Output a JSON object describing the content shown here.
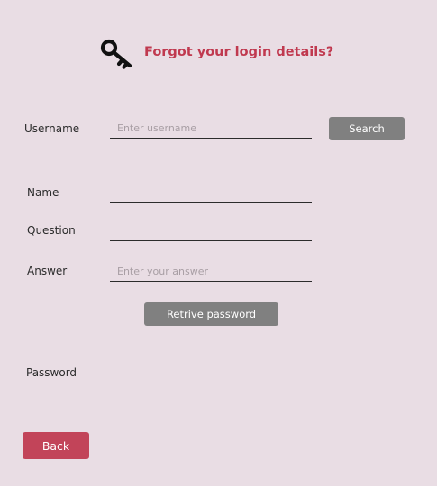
{
  "header": {
    "title": "Forgot your login details?",
    "icon": "key-icon"
  },
  "colors": {
    "background": "#e9dde4",
    "accent": "#c0394f",
    "button_grey": "#808080",
    "button_red": "#c24459"
  },
  "form": {
    "username": {
      "label": "Username",
      "value": "",
      "placeholder": "Enter username"
    },
    "search_label": "Search",
    "name": {
      "label": "Name",
      "value": ""
    },
    "question": {
      "label": "Question",
      "value": ""
    },
    "answer": {
      "label": "Answer",
      "value": "",
      "placeholder": "Enter your answer"
    },
    "retrieve_label": "Retrive password",
    "password": {
      "label": "Password",
      "value": ""
    }
  },
  "footer": {
    "back_label": "Back"
  }
}
